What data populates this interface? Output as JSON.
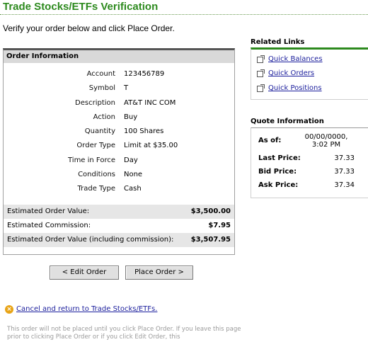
{
  "page": {
    "title": "Trade Stocks/ETFs Verification",
    "intro": "Verify your order below and click Place Order."
  },
  "order": {
    "header": "Order Information",
    "details": [
      {
        "label": "Account",
        "value": "123456789"
      },
      {
        "label": "Symbol",
        "value": "T"
      },
      {
        "label": "Description",
        "value": "AT&T INC COM"
      },
      {
        "label": "Action",
        "value": "Buy"
      },
      {
        "label": "Quantity",
        "value": "100 Shares"
      },
      {
        "label": "Order Type",
        "value": "Limit at $35.00"
      },
      {
        "label": "Time in Force",
        "value": "Day"
      },
      {
        "label": "Conditions",
        "value": "None"
      },
      {
        "label": "Trade Type",
        "value": "Cash"
      }
    ],
    "summary": [
      {
        "label": "Estimated Order Value:",
        "value": "$3,500.00"
      },
      {
        "label": "Estimated Commission:",
        "value": "$7.95"
      },
      {
        "label": "Estimated Order Value (including commission):",
        "value": "$3,507.95"
      }
    ]
  },
  "buttons": {
    "edit": "< Edit Order",
    "place": "Place Order >"
  },
  "cancel": {
    "icon": "x-circle-icon",
    "label": "Cancel and return to Trade Stocks/ETFs."
  },
  "disclaimer": "This order will not be placed until you click Place Order. If you leave this page prior to clicking Place Order or if you click Edit Order, this",
  "related_links": {
    "title": "Related Links",
    "items": [
      {
        "label": "Quick Balances",
        "icon": "external-link-icon"
      },
      {
        "label": "Quick Orders",
        "icon": "external-link-icon"
      },
      {
        "label": "Quick Positions",
        "icon": "external-link-icon"
      }
    ]
  },
  "quote": {
    "title": "Quote Information",
    "as_of_label": "As of:",
    "as_of_date": "00/00/0000,",
    "as_of_time": "3:02 PM",
    "rows": [
      {
        "label": "Last Price:",
        "value": "37.33"
      },
      {
        "label": "Bid Price:",
        "value": "37.33"
      },
      {
        "label": "Ask Price:",
        "value": "37.34"
      }
    ]
  },
  "colors": {
    "title_green": "#2d8a1e",
    "link_blue": "#1b1e9c",
    "cancel_orange": "#e8a417"
  }
}
